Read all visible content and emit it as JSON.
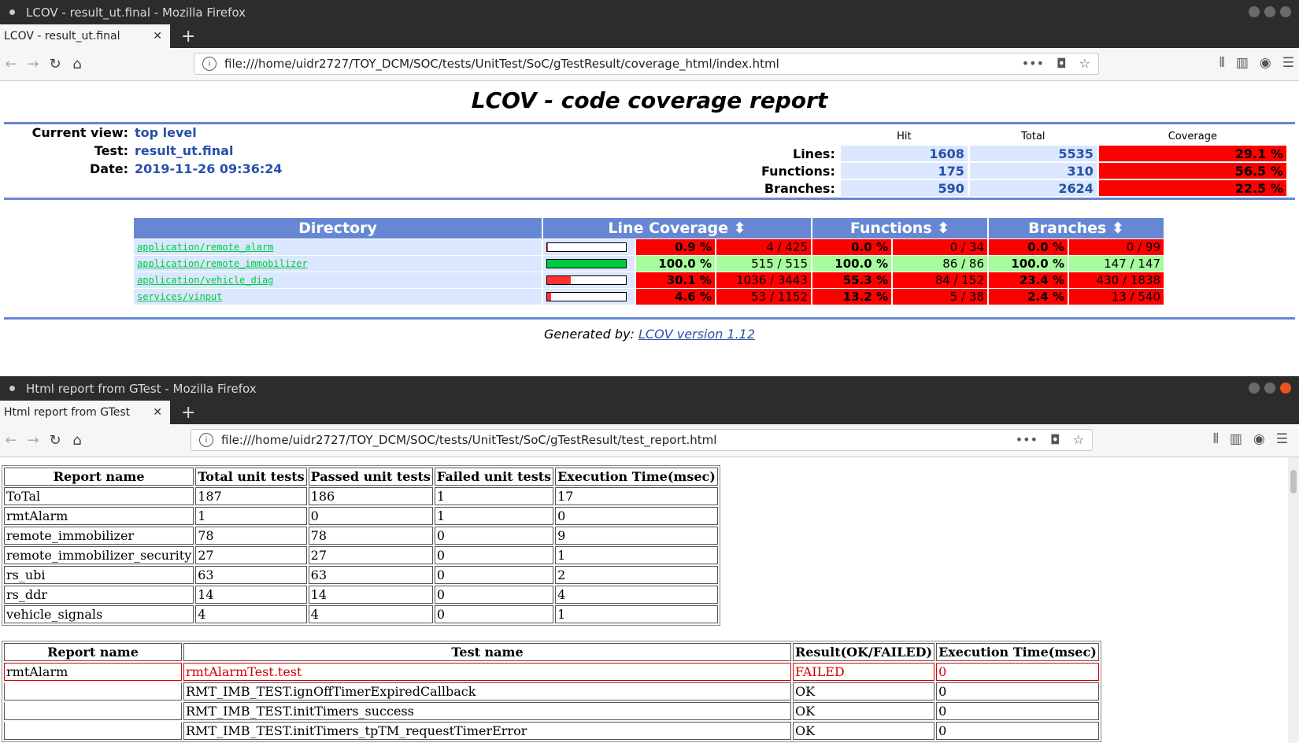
{
  "win1": {
    "title": "LCOV - result_ut.final - Mozilla Firefox",
    "tab_label": "LCOV - result_ut.final",
    "url": "file:///home/uidr2727/TOY_DCM/SOC/tests/UnitTest/SoC/gTestResult/coverage_html/index.html",
    "page": {
      "heading": "LCOV - code coverage report",
      "current_view_label": "Current view:",
      "current_view": "top level",
      "test_label": "Test:",
      "test": "result_ut.final",
      "date_label": "Date:",
      "date": "2019-11-26 09:36:24",
      "summary": {
        "col_hit": "Hit",
        "col_total": "Total",
        "col_coverage": "Coverage",
        "rows": [
          {
            "label": "Lines:",
            "hit": "1608",
            "total": "5535",
            "coverage": "29.1 %"
          },
          {
            "label": "Functions:",
            "hit": "175",
            "total": "310",
            "coverage": "56.5 %"
          },
          {
            "label": "Branches:",
            "hit": "590",
            "total": "2624",
            "coverage": "22.5 %"
          }
        ]
      },
      "dir_table": {
        "headers": [
          "Directory",
          "Line Coverage ⬍",
          "Functions ⬍",
          "Branches ⬍"
        ],
        "rows": [
          {
            "dir": "application/remote_alarm",
            "line_frac": 0.009,
            "line_pct": "0.9 %",
            "line_cnt": "4 / 425",
            "fn_pct": "0.0 %",
            "fn_cnt": "0 / 34",
            "br_pct": "0.0 %",
            "br_cnt": "0 / 99",
            "level": "lo"
          },
          {
            "dir": "application/remote_immobilizer",
            "line_frac": 1.0,
            "line_pct": "100.0 %",
            "line_cnt": "515 / 515",
            "fn_pct": "100.0 %",
            "fn_cnt": "86 / 86",
            "br_pct": "100.0 %",
            "br_cnt": "147 / 147",
            "level": "hi"
          },
          {
            "dir": "application/vehicle_diag",
            "line_frac": 0.301,
            "line_pct": "30.1 %",
            "line_cnt": "1036 / 3443",
            "fn_pct": "55.3 %",
            "fn_cnt": "84 / 152",
            "br_pct": "23.4 %",
            "br_cnt": "430 / 1838",
            "level": "lo"
          },
          {
            "dir": "services/vinput",
            "line_frac": 0.046,
            "line_pct": "4.6 %",
            "line_cnt": "53 / 1152",
            "fn_pct": "13.2 %",
            "fn_cnt": "5 / 38",
            "br_pct": "2.4 %",
            "br_cnt": "13 / 540",
            "level": "lo"
          }
        ]
      },
      "generated_by": "Generated by:",
      "generator_link": "LCOV version 1.12"
    }
  },
  "win2": {
    "title": "Html report from GTest - Mozilla Firefox",
    "tab_label": "Html report from GTest",
    "url": "file:///home/uidr2727/TOY_DCM/SOC/tests/UnitTest/SoC/gTestResult/test_report.html",
    "summary_table": {
      "headers": [
        "Report name",
        "Total unit tests",
        "Passed unit tests",
        "Failed unit tests",
        "Execution Time(msec)"
      ],
      "rows": [
        [
          "ToTal",
          "187",
          "186",
          "1",
          "17"
        ],
        [
          "rmtAlarm",
          "1",
          "0",
          "1",
          "0"
        ],
        [
          "remote_immobilizer",
          "78",
          "78",
          "0",
          "9"
        ],
        [
          "remote_immobilizer_security",
          "27",
          "27",
          "0",
          "1"
        ],
        [
          "rs_ubi",
          "63",
          "63",
          "0",
          "2"
        ],
        [
          "rs_ddr",
          "14",
          "14",
          "0",
          "4"
        ],
        [
          "vehicle_signals",
          "4",
          "4",
          "0",
          "1"
        ]
      ]
    },
    "detail_table": {
      "headers": [
        "Report name",
        "Test name",
        "Result(OK/FAILED)",
        "Execution Time(msec)"
      ],
      "rows": [
        {
          "report": "rmtAlarm",
          "test": "rmtAlarmTest.test",
          "result": "FAILED",
          "time": "0",
          "failed": true
        },
        {
          "report": "",
          "test": "RMT_IMB_TEST.ignOffTimerExpiredCallback",
          "result": "OK",
          "time": "0",
          "failed": false
        },
        {
          "report": "",
          "test": "RMT_IMB_TEST.initTimers_success",
          "result": "OK",
          "time": "0",
          "failed": false
        },
        {
          "report": "",
          "test": "RMT_IMB_TEST.initTimers_tpTM_requestTimerError",
          "result": "OK",
          "time": "0",
          "failed": false
        }
      ]
    }
  },
  "colors": {
    "accent": "#6688d4",
    "hit": "#a7fc9d",
    "low": "#ff0000",
    "cell": "#dae7fe",
    "link": "#284fa8",
    "bar_high": "#00cb40",
    "bar_low": "#ff3030"
  }
}
